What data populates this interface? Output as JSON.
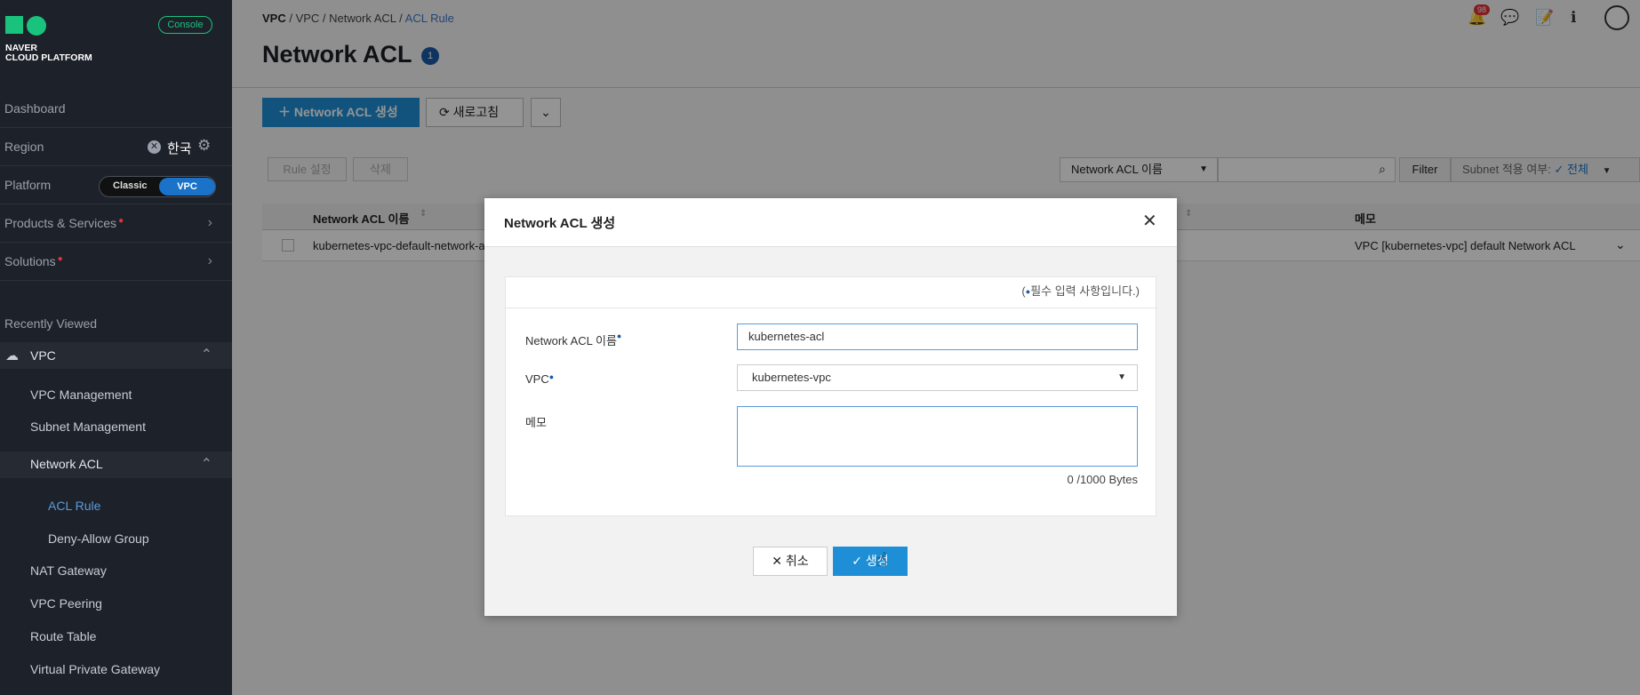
{
  "sidebar": {
    "logo_text": "NAVER\nCLOUD PLATFORM",
    "console_label": "Console",
    "dashboard": "Dashboard",
    "region_label": "Region",
    "region_value": "한국",
    "platform_label": "Platform",
    "platform_classic": "Classic",
    "platform_vpc": "VPC",
    "products_label": "Products & Services",
    "solutions_label": "Solutions",
    "recently_viewed": "Recently Viewed",
    "vpc_section": "VPC",
    "items": [
      {
        "label": "VPC Management"
      },
      {
        "label": "Subnet Management"
      },
      {
        "label": "Network ACL"
      },
      {
        "label": "ACL Rule"
      },
      {
        "label": "Deny-Allow Group"
      },
      {
        "label": "NAT Gateway"
      },
      {
        "label": "VPC Peering"
      },
      {
        "label": "Route Table"
      },
      {
        "label": "Virtual Private Gateway"
      }
    ]
  },
  "header": {
    "breadcrumb": [
      "VPC",
      "VPC",
      "Network ACL",
      "ACL Rule"
    ],
    "title": "Network ACL",
    "title_badge": "1",
    "notif_count": "98"
  },
  "toolbar": {
    "create_label": "Network ACL 생성",
    "refresh_label": "새로고침",
    "rule_label": "Rule 설정",
    "delete_label": "삭제",
    "search_field": "Network ACL 이름",
    "filter_label": "Filter",
    "subnet_filter_label": "Subnet 적용 여부:",
    "subnet_filter_value": "전체"
  },
  "table": {
    "columns": [
      "Network ACL 이름",
      "메모"
    ],
    "rows": [
      {
        "name": "kubernetes-vpc-default-network-a",
        "memo": "VPC [kubernetes-vpc] default Network ACL"
      }
    ]
  },
  "modal": {
    "title": "Network ACL 생성",
    "required_note": "필수 입력 사항입니다.)",
    "required_note_prefix": "(",
    "name_label": "Network ACL 이름",
    "name_value": "kubernetes-acl",
    "vpc_label": "VPC",
    "vpc_value": "kubernetes-vpc",
    "memo_label": "메모",
    "bytes": "0 /1000 Bytes",
    "cancel_label": "취소",
    "ok_label": "생성"
  },
  "colors": {
    "accent": "#1e8fd6",
    "sidebar_bg": "#1d2129",
    "brand_green": "#19c37d"
  }
}
